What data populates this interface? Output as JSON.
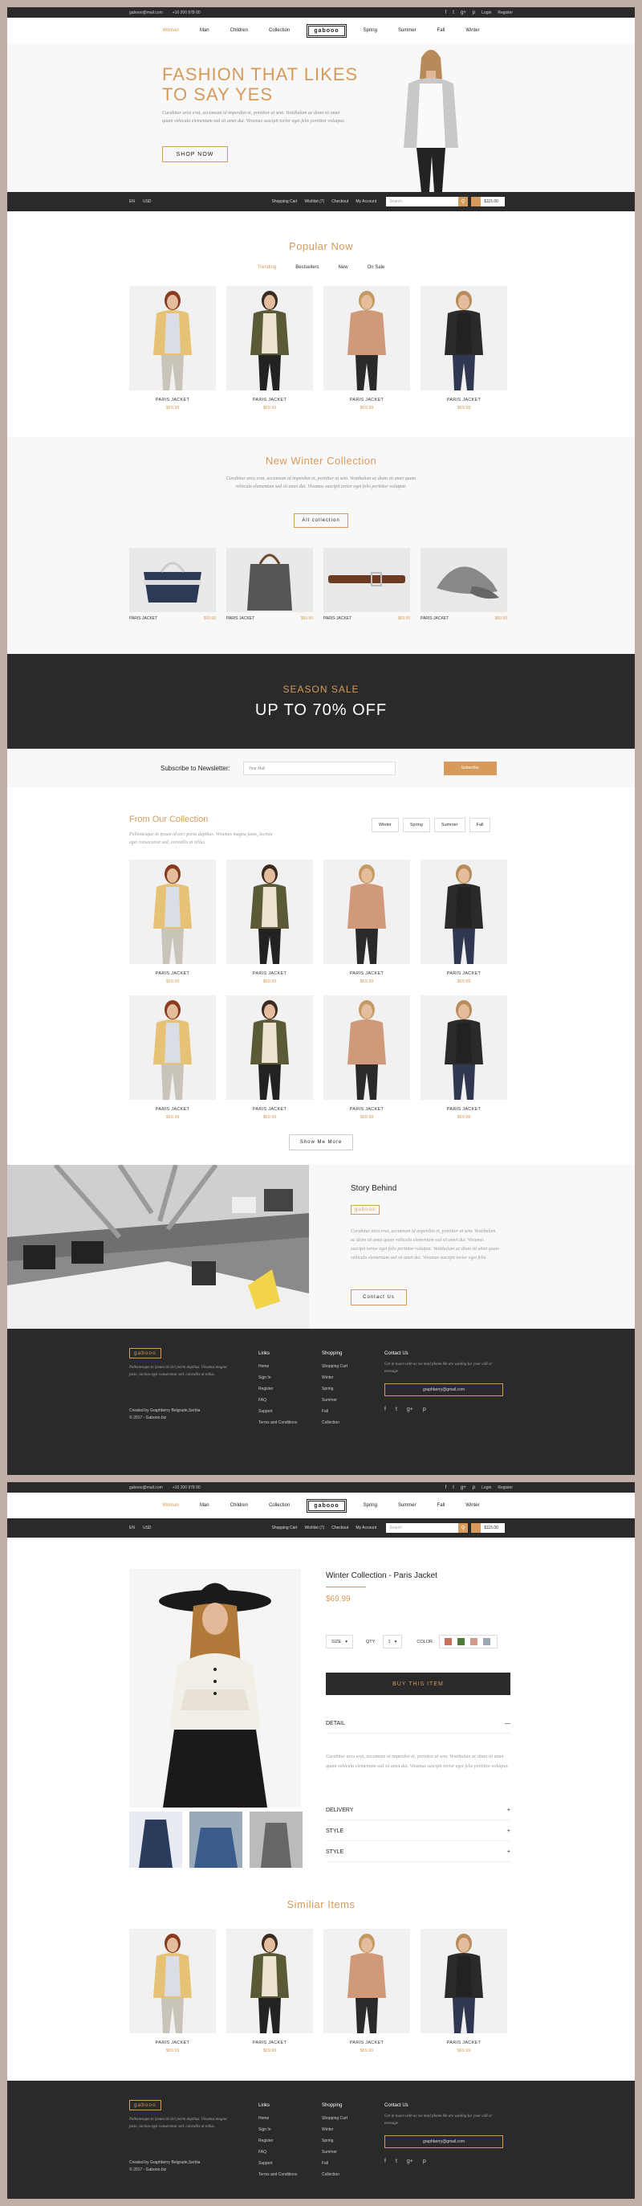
{
  "topbar": {
    "email": "gabooo@mail.com",
    "phone": "+10 200 978 00",
    "login": "Login",
    "register": "Register",
    "social": [
      "f",
      "t",
      "g+",
      "p"
    ]
  },
  "nav": {
    "left": [
      "Woman",
      "Man",
      "Children",
      "Collection"
    ],
    "logo": "gabooo",
    "right": [
      "Spring",
      "Summer",
      "Fall",
      "Winter"
    ]
  },
  "hero": {
    "title": "FASHION THAT LIKES TO SAY YES",
    "text": "Curabitur arcu erat, accumsan id imperdiet et, porttitor at sem. Vestibulum ac diam sit amet quam vehicula elementum sed sit amet dui. Vivamus suscipit tortor eget felis porttitor volutpat.",
    "button": "SHOP NOW"
  },
  "bar": {
    "lang": "EN",
    "currency": "USD",
    "links": [
      "Shopping Cart",
      "Wishlist (7)",
      "Checkout",
      "My Account"
    ],
    "search_placeholder": "Search",
    "amount": "$115.00"
  },
  "popular": {
    "title": "Popular Now",
    "tabs": [
      "Trending",
      "Bestsellers",
      "New",
      "On Sale"
    ],
    "items": [
      {
        "name": "PARIS JACKET",
        "price": "$69.99"
      },
      {
        "name": "PARIS JACKET",
        "price": "$69.99"
      },
      {
        "name": "PARIS JACKET",
        "price": "$69.99"
      },
      {
        "name": "PARIS JACKET",
        "price": "$69.99"
      }
    ]
  },
  "winter": {
    "title": "New Winter Collection",
    "text": "Curabitur arcu erat, accumsan id imperdiet et, porttitor at sem. Vestibulum ac diam sit amet quam vehicula elementum sed sit amet dui. Vivamus suscipit tortor eget felis porttitor volutpat.",
    "button": "All collection",
    "items": [
      {
        "name": "PARIS JACKET",
        "price": "$69.99"
      },
      {
        "name": "PARIS JACKET",
        "price": "$69.99"
      },
      {
        "name": "PARIS JACKET",
        "price": "$69.99"
      },
      {
        "name": "PARIS JACKET",
        "price": "$69.99"
      }
    ]
  },
  "sale": {
    "line1": "SEASON SALE",
    "line2": "UP TO 70% OFF"
  },
  "newsletter": {
    "label": "Subscribe to Newsletter:",
    "placeholder": "Your Mail",
    "button": "Subscribe"
  },
  "collection": {
    "title": "From Our Collection",
    "text": "Pellentesque in ipsum id orci porta dapibus. Vivamus magna justo, lacinia eget consectetur sed, convallis at tellus.",
    "filters": [
      "Winter",
      "Spring",
      "Summer",
      "Fall"
    ],
    "row1": [
      {
        "name": "PARIS JACKET",
        "price": "$69.99"
      },
      {
        "name": "PARIS JACKET",
        "price": "$69.99"
      },
      {
        "name": "PARIS JACKET",
        "price": "$69.99"
      },
      {
        "name": "PARIS JACKET",
        "price": "$69.99"
      }
    ],
    "row2": [
      {
        "name": "PARIS JACKET",
        "price": "$69.99"
      },
      {
        "name": "PARIS JACKET",
        "price": "$69.99"
      },
      {
        "name": "PARIS JACKET",
        "price": "$69.99"
      },
      {
        "name": "PARIS JACKET",
        "price": "$69.99"
      }
    ],
    "more": "Show Me More"
  },
  "story": {
    "title": "Story Behind",
    "logo": "gabooo",
    "text": "Curabitur arcu erat, accumsan id imperdiet et, porttitor at sem. Vestibulum ac diam sit amet quam vehicula elementum sed sit amet dui. Vivamus suscipit tortor eget felis porttitor volutpat. Vestibulum ac diam sit amet quam vehicula elementum sed sit amet dui. Vivamus suscipit tortor eget felis.",
    "button": "Contact Us"
  },
  "footer": {
    "logo": "gabooo",
    "text": "Pellentesque in ipsum id orci porta dapibus. Vivamus magna justo, lacinia eget consectetur sed, convallis at tellus.",
    "credit1": "Created by Graphberry Belgrade,Serbia",
    "credit2": "© 2017 - Gabooo.biz",
    "links_title": "Links",
    "links": [
      "Home",
      "Sign In",
      "Register",
      "FAQ",
      "Support",
      "Terms and Conditions"
    ],
    "shop_title": "Shopping",
    "shop": [
      "Shopping Cart",
      "Winter",
      "Spring",
      "Summer",
      "Fall",
      "Collection"
    ],
    "contact_title": "Contact Us",
    "contact_text": "Get in touch with us via mail phone.We are waiting for your call or message",
    "email": "graphberry@gmail.com"
  },
  "product": {
    "title": "Winter Collection - Paris Jacket",
    "price": "$69.99",
    "size": "SIZE",
    "qty_label": "QTY:",
    "qty": "1",
    "color": "COLOR",
    "swatches": [
      "#c7705d",
      "#4f7a3a",
      "#d19a8a",
      "#9ba7b3"
    ],
    "buy": "BUY THIS ITEM",
    "detail": "DETAIL",
    "detail_text": "Curabitur arcu erat, accumsan id imperdiet et, porttitor at sem. Vestibulum ac diam sit amet quam vehicula elementum sed sit amet dui. Vivamus suscipit tortor eget felis porttitor volutpat.",
    "sections": [
      "DELIVERY",
      "STYLE",
      "STYLE"
    ]
  },
  "similar": {
    "title": "Similiar Items",
    "items": [
      {
        "name": "PARIS JACKET",
        "price": "$69.99"
      },
      {
        "name": "PARIS JACKET",
        "price": "$69.99"
      },
      {
        "name": "PARIS JACKET",
        "price": "$69.99"
      },
      {
        "name": "PARIS JACKET",
        "price": "$69.99"
      }
    ]
  }
}
